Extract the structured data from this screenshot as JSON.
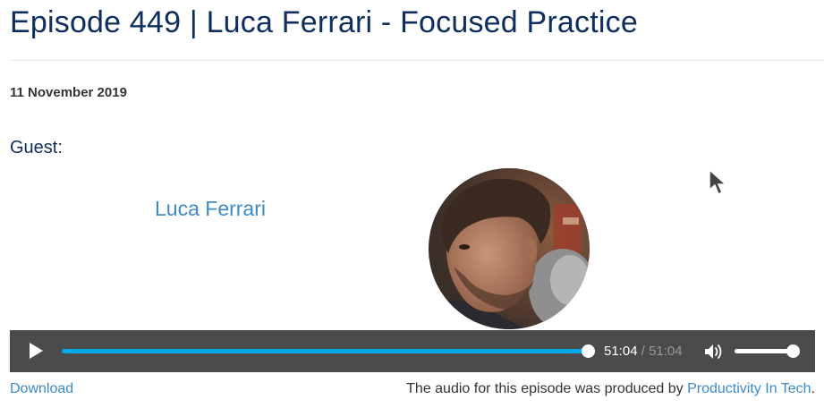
{
  "episode": {
    "title": "Episode 449 | Luca Ferrari - Focused Practice",
    "date": "11 November 2019",
    "guest_label": "Guest:",
    "guest_name": "Luca Ferrari"
  },
  "player": {
    "current_time": "51:04",
    "separator": "/",
    "duration": "51:04",
    "progress_fraction": 1.0,
    "volume_fraction": 1.0,
    "accent_color": "#00a8e8",
    "background_color": "#4b4b4b",
    "play_icon": "play-icon",
    "volume_icon": "volume-high-icon"
  },
  "footer": {
    "download_label": "Download",
    "credit_text": "The audio for this episode was produced by ",
    "credit_link": "Productivity In Tech",
    "credit_end": "."
  },
  "colors": {
    "title": "#0d2e5e",
    "link": "#3d8ac9"
  }
}
